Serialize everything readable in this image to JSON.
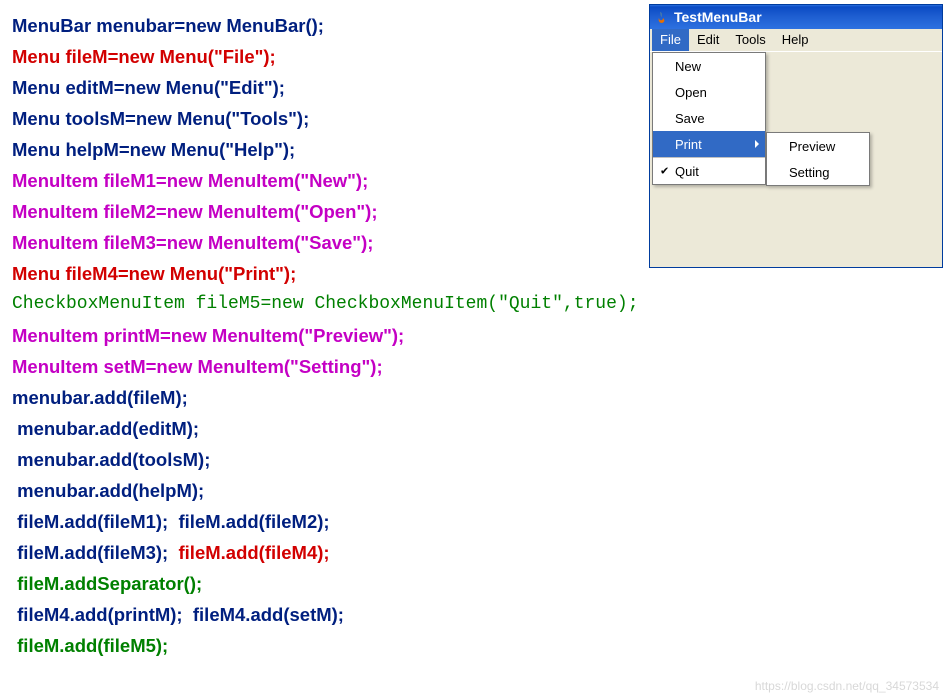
{
  "code": {
    "l1": "MenuBar menubar=new MenuBar();",
    "l2": "Menu fileM=new Menu(\"File\");",
    "l3": "Menu editM=new Menu(\"Edit\");",
    "l4": "Menu toolsM=new Menu(\"Tools\");",
    "l5": "Menu helpM=new Menu(\"Help\");",
    "l6": "MenuItem fileM1=new MenuItem(\"New\");",
    "l7": "MenuItem fileM2=new MenuItem(\"Open\");",
    "l8": "MenuItem fileM3=new MenuItem(\"Save\");",
    "l9": "Menu fileM4=new Menu(\"Print\");",
    "l10": "CheckboxMenuItem fileM5=new CheckboxMenuItem(\"Quit\",true);",
    "l11": "MenuItem printM=new MenuItem(\"Preview\");",
    "l12": "MenuItem setM=new MenuItem(\"Setting\");",
    "l13": "menubar.add(fileM);",
    "l14": " menubar.add(editM);",
    "l15": " menubar.add(toolsM);",
    "l16": " menubar.add(helpM);",
    "l17a": " fileM.add(fileM1);  ",
    "l17b": "fileM.add(fileM2);",
    "l18a": " fileM.add(fileM3);  ",
    "l18b": "fileM.add(fileM4);",
    "l19": " fileM.addSeparator();",
    "l20a": " fileM4.add(printM);  ",
    "l20b": "fileM4.add(setM);",
    "l21": " fileM.add(fileM5);"
  },
  "window": {
    "title": "TestMenuBar",
    "menus": {
      "file": "File",
      "edit": "Edit",
      "tools": "Tools",
      "help": "Help"
    },
    "fileMenu": {
      "new": "New",
      "open": "Open",
      "save": "Save",
      "print": "Print",
      "quit": "Quit"
    },
    "printSubmenu": {
      "preview": "Preview",
      "setting": "Setting"
    }
  },
  "watermark": "https://blog.csdn.net/qq_34573534"
}
